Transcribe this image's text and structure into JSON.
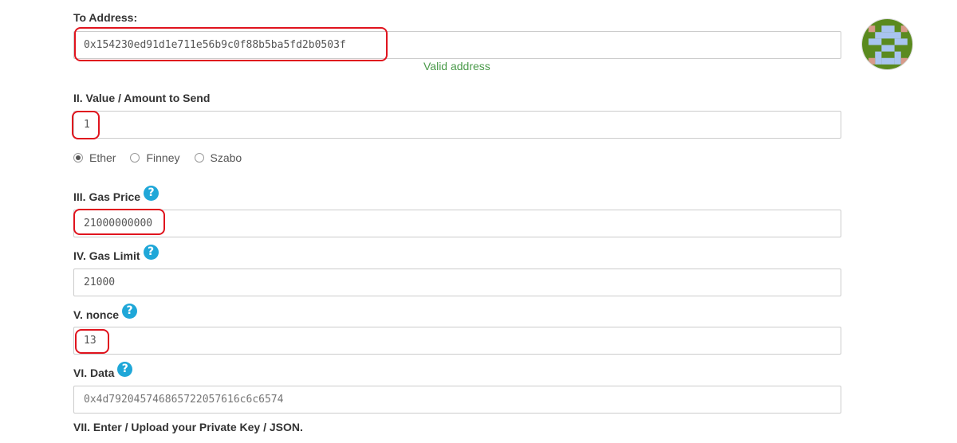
{
  "to_address": {
    "label": "To Address:",
    "value": "0x154230ed91d1e711e56b9c0f88b5ba5fd2b0503f",
    "validation": "Valid address"
  },
  "value_section": {
    "label": "II. Value / Amount to Send",
    "value": "1",
    "units": [
      {
        "label": "Ether",
        "checked": true
      },
      {
        "label": "Finney",
        "checked": false
      },
      {
        "label": "Szabo",
        "checked": false
      }
    ]
  },
  "gas_price": {
    "label": "III. Gas Price",
    "value": "21000000000"
  },
  "gas_limit": {
    "label": "IV. Gas Limit",
    "value": "21000"
  },
  "nonce": {
    "label": "V. nonce",
    "value": "13"
  },
  "data_field": {
    "label": "VI. Data",
    "placeholder": "0x4d792045746865722057616c6c6574"
  },
  "private_key": {
    "label": "VII. Enter / Upload your Private Key / JSON."
  },
  "help_glyph": "?",
  "colors": {
    "highlight": "#e0141e",
    "valid_text": "#4a9a4a",
    "help_icon": "#1fa7d8",
    "identicon_green": "#5a8a1f",
    "identicon_blue": "#a8c4f0",
    "identicon_pink": "#d89a8a"
  }
}
